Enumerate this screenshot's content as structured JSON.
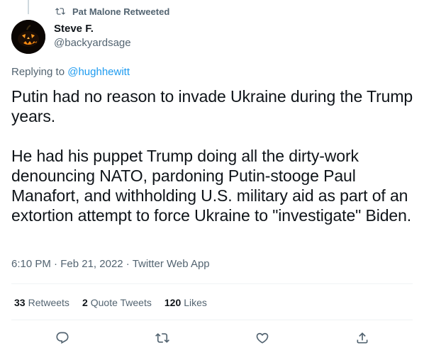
{
  "retweet_context": {
    "text": "Pat Malone Retweeted",
    "icon": "retweet-icon"
  },
  "author": {
    "display_name": "Steve F.",
    "handle": "@backyardsage",
    "avatar": "jack-o-lantern-avatar"
  },
  "replying_to": {
    "prefix": "Replying to ",
    "user": "@hughhewitt"
  },
  "tweet": {
    "paragraphs": [
      "Putin had no reason to invade Ukraine during the Trump years.",
      "He had his puppet Trump doing all the dirty-work denouncing NATO, pardoning Putin-stooge Paul Manafort, and withholding U.S. military aid as part of an extortion attempt to force Ukraine to \"investigate\" Biden."
    ]
  },
  "meta": {
    "time": "6:10 PM",
    "separator": " · ",
    "date": "Feb 21, 2022",
    "source": "Twitter Web App"
  },
  "stats": [
    {
      "count": "33",
      "label": "Retweets"
    },
    {
      "count": "2",
      "label": "Quote Tweets"
    },
    {
      "count": "120",
      "label": "Likes"
    }
  ],
  "actions": [
    "reply-icon",
    "retweet-icon",
    "like-icon",
    "share-icon"
  ],
  "colors": {
    "link": "#1d9bf0",
    "secondary": "#536471",
    "primary": "#0f1419",
    "divider": "#eff3f4"
  }
}
